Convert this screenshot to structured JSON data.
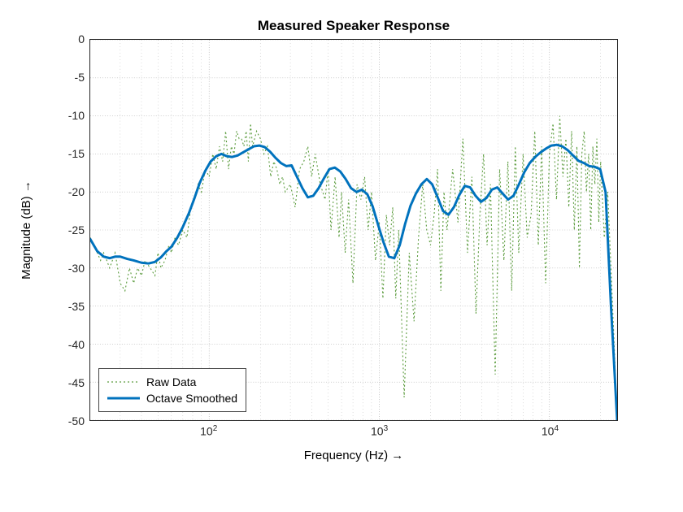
{
  "chart_data": {
    "type": "line",
    "title": "Measured Speaker Response",
    "xlabel": "Frequency (Hz)  →",
    "ylabel": "Magnitude (dB)  →",
    "xscale": "log",
    "xlim": [
      20,
      25000
    ],
    "ylim": [
      -50,
      0
    ],
    "xticks_major": [
      100,
      1000,
      10000
    ],
    "xticks_major_labels": [
      "10^2",
      "10^3",
      "10^4"
    ],
    "yticks": [
      -50,
      -45,
      -40,
      -35,
      -30,
      -25,
      -20,
      -15,
      -10,
      -5,
      0
    ],
    "grid": true,
    "legend": {
      "position": "southwest",
      "entries": [
        "Raw Data",
        "Octave Smoothed"
      ]
    },
    "colors": {
      "raw": "#5a9b3c",
      "smoothed": "#0072BD",
      "grid_major": "#b0b0b0",
      "grid_minor": "#b8b8b8"
    },
    "series": [
      {
        "name": "Raw Data",
        "style": "dotted",
        "color": "#5a9b3c",
        "x": [
          20,
          21,
          22,
          23,
          24,
          25,
          26,
          28,
          30,
          32,
          34,
          36,
          38,
          40,
          42,
          45,
          48,
          50,
          52,
          55,
          58,
          60,
          63,
          66,
          70,
          74,
          78,
          82,
          86,
          90,
          95,
          100,
          105,
          110,
          115,
          120,
          125,
          130,
          135,
          140,
          145,
          150,
          155,
          160,
          165,
          170,
          175,
          180,
          190,
          200,
          210,
          220,
          230,
          240,
          250,
          260,
          270,
          280,
          300,
          320,
          340,
          360,
          380,
          400,
          420,
          450,
          480,
          500,
          520,
          550,
          580,
          600,
          630,
          660,
          700,
          740,
          780,
          820,
          860,
          900,
          950,
          1000,
          1050,
          1100,
          1150,
          1200,
          1250,
          1300,
          1400,
          1500,
          1600,
          1700,
          1800,
          1900,
          2000,
          2100,
          2200,
          2300,
          2400,
          2500,
          2700,
          2900,
          3100,
          3300,
          3500,
          3700,
          3900,
          4100,
          4300,
          4500,
          4800,
          5100,
          5400,
          5700,
          6000,
          6300,
          6600,
          7000,
          7400,
          7800,
          8200,
          8600,
          9000,
          9500,
          10000,
          10500,
          11000,
          11500,
          12000,
          12500,
          13000,
          13500,
          14000,
          14500,
          15000,
          15500,
          16000,
          16500,
          17000,
          17500,
          18000,
          18500,
          19000,
          19500,
          20000,
          21000,
          22000,
          23000,
          24000,
          25000
        ],
        "y": [
          -26,
          -27,
          -28,
          -29,
          -28,
          -29,
          -30,
          -28,
          -32,
          -33,
          -30,
          -32,
          -30,
          -31,
          -29,
          -30,
          -31,
          -28,
          -30,
          -29,
          -27,
          -28,
          -26,
          -27,
          -25,
          -26,
          -22,
          -21,
          -19,
          -20,
          -17,
          -18,
          -15,
          -17,
          -14,
          -16,
          -12,
          -17,
          -14,
          -15,
          -12,
          -13,
          -13,
          -14,
          -12,
          -16,
          -11,
          -14,
          -12,
          -13,
          -15,
          -14,
          -18,
          -16,
          -17,
          -19,
          -18,
          -20,
          -19,
          -22,
          -17,
          -16,
          -14,
          -18,
          -15,
          -19,
          -21,
          -17,
          -25,
          -18,
          -26,
          -20,
          -28,
          -21,
          -32,
          -19,
          -21,
          -18,
          -25,
          -20,
          -29,
          -24,
          -34,
          -23,
          -27,
          -22,
          -34,
          -25,
          -47,
          -28,
          -37,
          -26,
          -19,
          -25,
          -27,
          -23,
          -17,
          -33,
          -20,
          -25,
          -17,
          -24,
          -13,
          -28,
          -18,
          -36,
          -23,
          -15,
          -27,
          -19,
          -44,
          -17,
          -29,
          -16,
          -33,
          -14,
          -28,
          -15,
          -26,
          -23,
          -12,
          -27,
          -14,
          -32,
          -15,
          -11,
          -21,
          -10,
          -18,
          -13,
          -22,
          -12,
          -25,
          -14,
          -30,
          -15,
          -12,
          -20,
          -15,
          -25,
          -14,
          -19,
          -13,
          -24,
          -16,
          -26,
          -20,
          -30,
          -40,
          -50
        ]
      },
      {
        "name": "Octave Smoothed",
        "style": "solid",
        "color": "#0072BD",
        "width": 3,
        "x": [
          20,
          22,
          24,
          26,
          28,
          30,
          33,
          36,
          40,
          44,
          48,
          52,
          56,
          60,
          65,
          70,
          76,
          82,
          88,
          95,
          102,
          110,
          118,
          127,
          136,
          147,
          158,
          170,
          183,
          197,
          212,
          228,
          245,
          264,
          284,
          305,
          328,
          353,
          380,
          409,
          440,
          473,
          509,
          548,
          589,
          634,
          682,
          734,
          790,
          850,
          914,
          983,
          1058,
          1138,
          1225,
          1318,
          1418,
          1526,
          1642,
          1767,
          1902,
          2046,
          2202,
          2369,
          2550,
          2744,
          2952,
          3177,
          3419,
          3679,
          3959,
          4260,
          4584,
          4933,
          5308,
          5712,
          6147,
          6614,
          7117,
          7658,
          8241,
          8868,
          9542,
          10268,
          11049,
          11890,
          12795,
          13768,
          14815,
          15942,
          17155,
          18460,
          19864,
          21375,
          23001,
          25000
        ],
        "y": [
          -26.2,
          -27.8,
          -28.5,
          -28.7,
          -28.5,
          -28.5,
          -28.8,
          -29.0,
          -29.3,
          -29.4,
          -29.2,
          -28.6,
          -27.8,
          -27.2,
          -26.0,
          -24.6,
          -22.8,
          -20.8,
          -18.8,
          -17.2,
          -16.0,
          -15.3,
          -15.0,
          -15.3,
          -15.4,
          -15.2,
          -14.8,
          -14.4,
          -14.0,
          -13.9,
          -14.1,
          -14.7,
          -15.5,
          -16.2,
          -16.6,
          -16.5,
          -18.0,
          -19.5,
          -20.7,
          -20.5,
          -19.5,
          -18.2,
          -17.0,
          -16.8,
          -17.3,
          -18.3,
          -19.5,
          -20.0,
          -19.7,
          -20.3,
          -21.9,
          -24.3,
          -26.6,
          -28.5,
          -28.7,
          -27.0,
          -24.2,
          -21.8,
          -20.2,
          -19.0,
          -18.3,
          -19.0,
          -20.7,
          -22.5,
          -23.0,
          -22.0,
          -20.4,
          -19.2,
          -19.4,
          -20.5,
          -21.3,
          -20.8,
          -19.7,
          -19.4,
          -20.2,
          -21.0,
          -20.5,
          -19.0,
          -17.4,
          -16.2,
          -15.4,
          -14.8,
          -14.3,
          -13.9,
          -13.8,
          -14.0,
          -14.5,
          -15.2,
          -15.9,
          -16.2,
          -16.6,
          -16.7,
          -17.0,
          -20.0,
          -35.0,
          -50.0
        ]
      }
    ]
  }
}
